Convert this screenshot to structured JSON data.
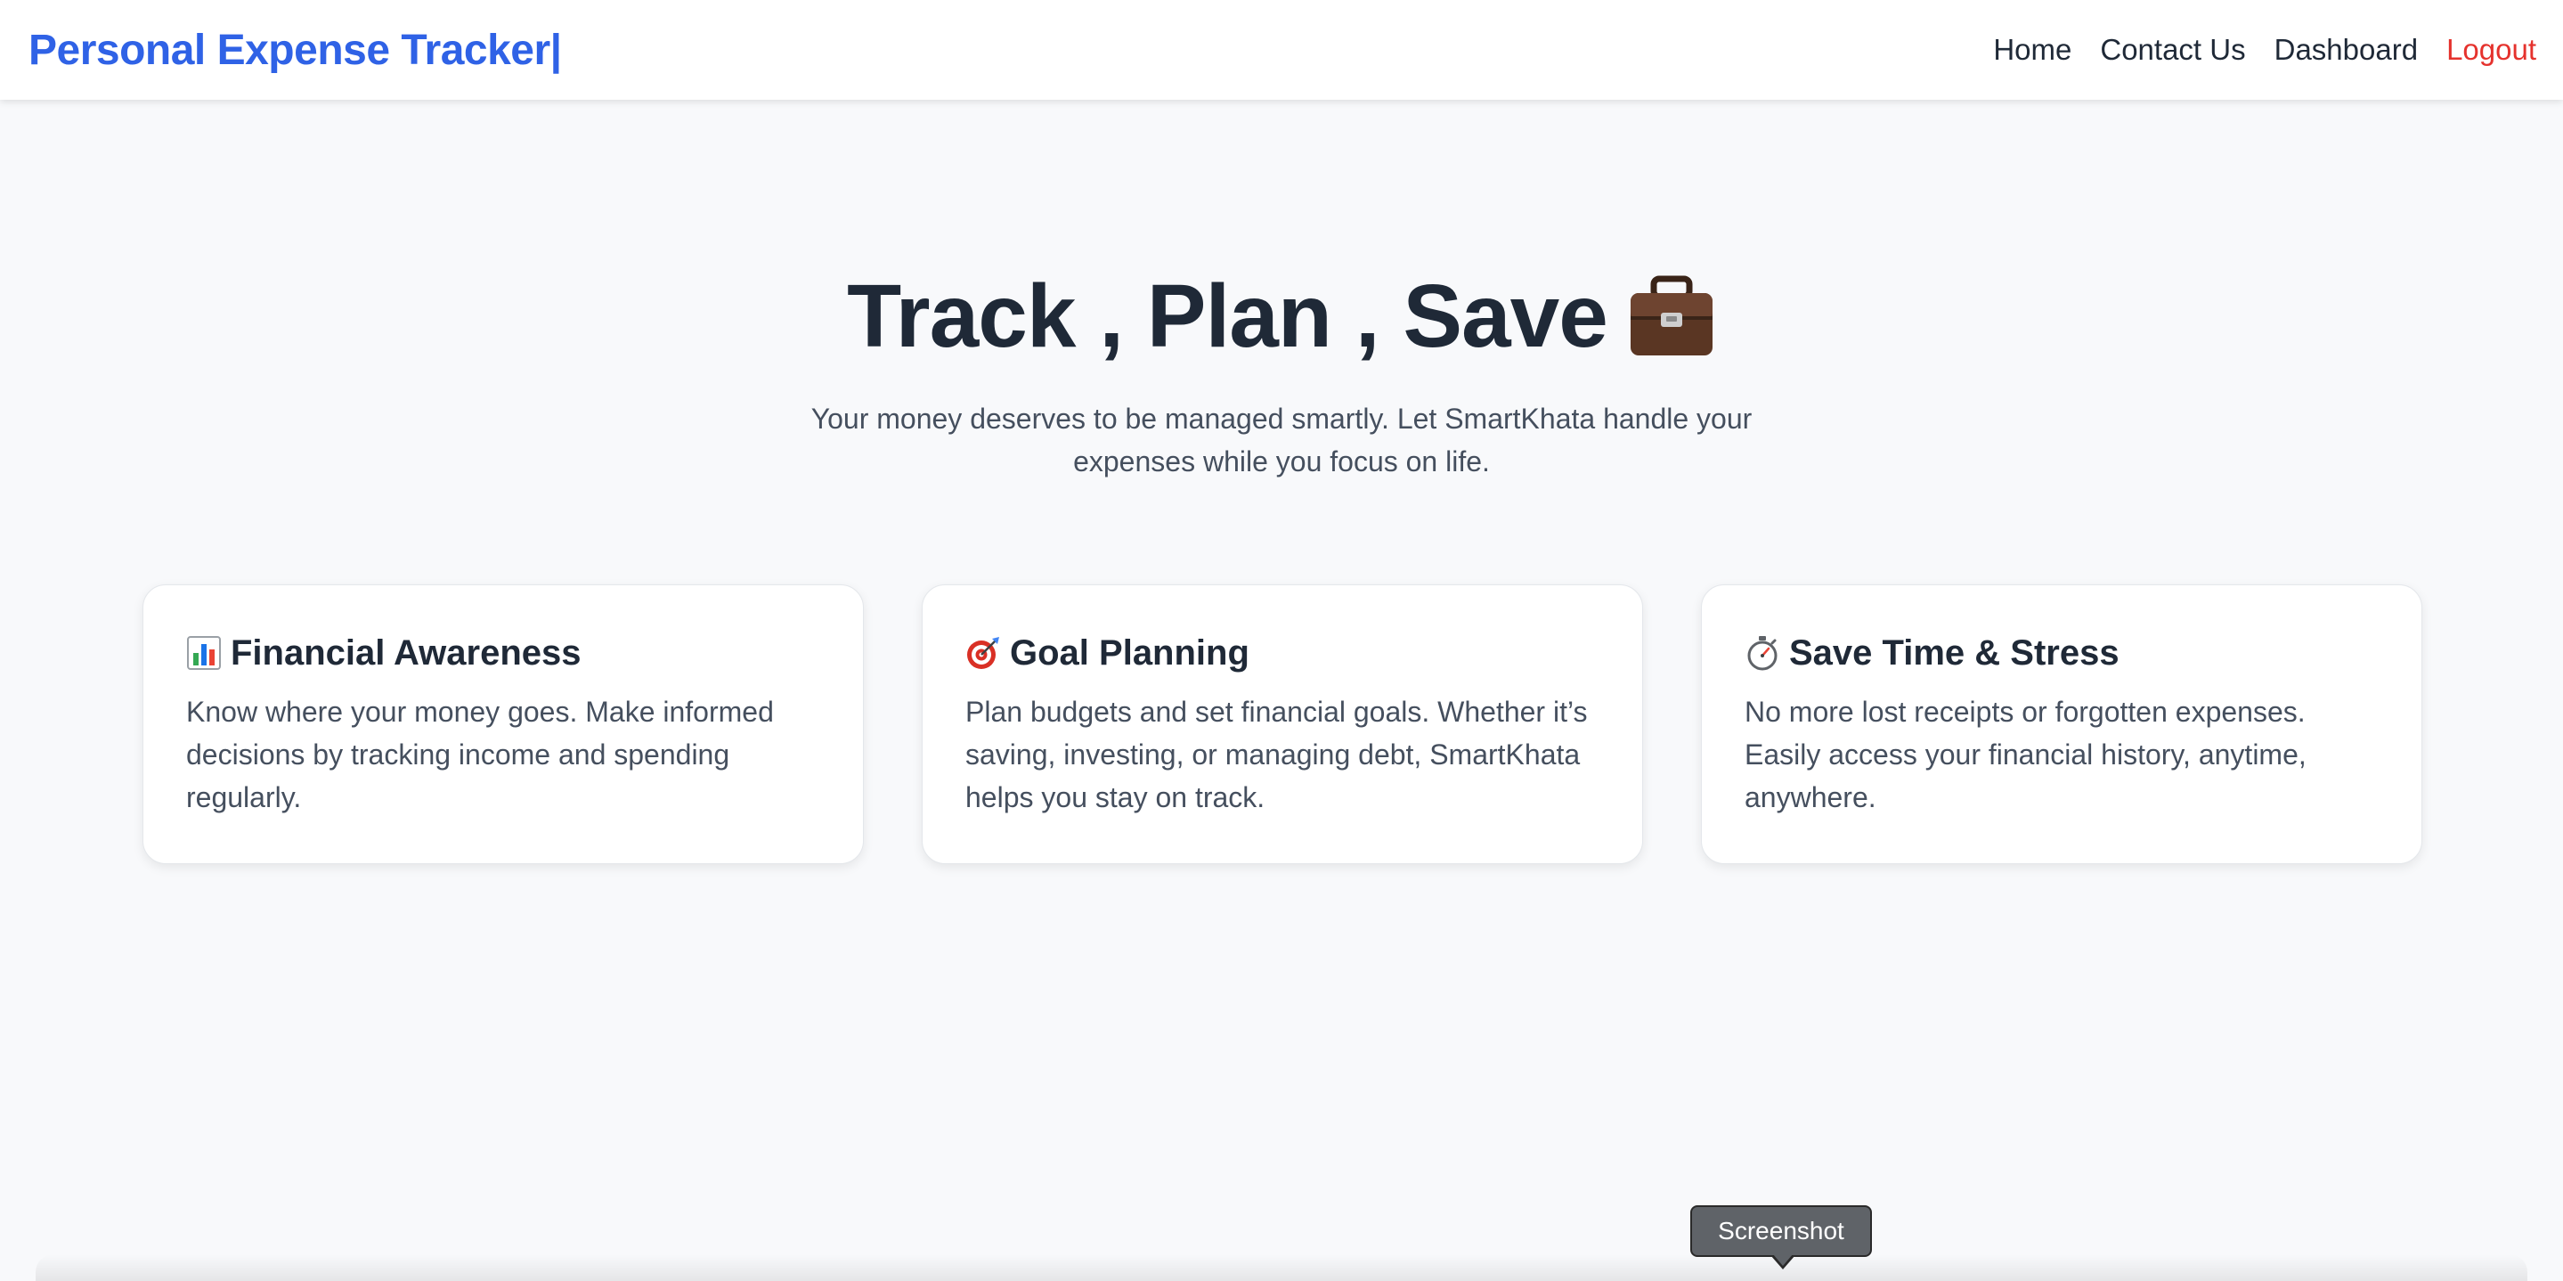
{
  "brand": {
    "label": "Personal Expense Tracker|",
    "color": "#2f62e6"
  },
  "nav": {
    "items": [
      {
        "label": "Home"
      },
      {
        "label": "Contact Us"
      },
      {
        "label": "Dashboard"
      },
      {
        "label": "Logout",
        "color": "#e5322d"
      }
    ]
  },
  "hero": {
    "title": "Track , Plan , Save",
    "title_icon": "briefcase-icon",
    "subtitle": "Your money deserves to be managed smartly. Let SmartKhata handle your expenses while you focus on life."
  },
  "cards": [
    {
      "icon": "bar-chart-icon",
      "title": "Financial Awareness",
      "text": "Know where your money goes. Make informed decisions by tracking income and spending regularly."
    },
    {
      "icon": "target-icon",
      "title": "Goal Planning",
      "text": "Plan budgets and set financial goals. Whether it’s saving, investing, or managing debt, SmartKhata helps you stay on track."
    },
    {
      "icon": "stopwatch-icon",
      "title": "Save Time & Stress",
      "text": "No more lost receipts or forgotten expenses. Easily access your financial history, anytime, anywhere."
    }
  ],
  "tooltip": {
    "label": "Screenshot"
  }
}
